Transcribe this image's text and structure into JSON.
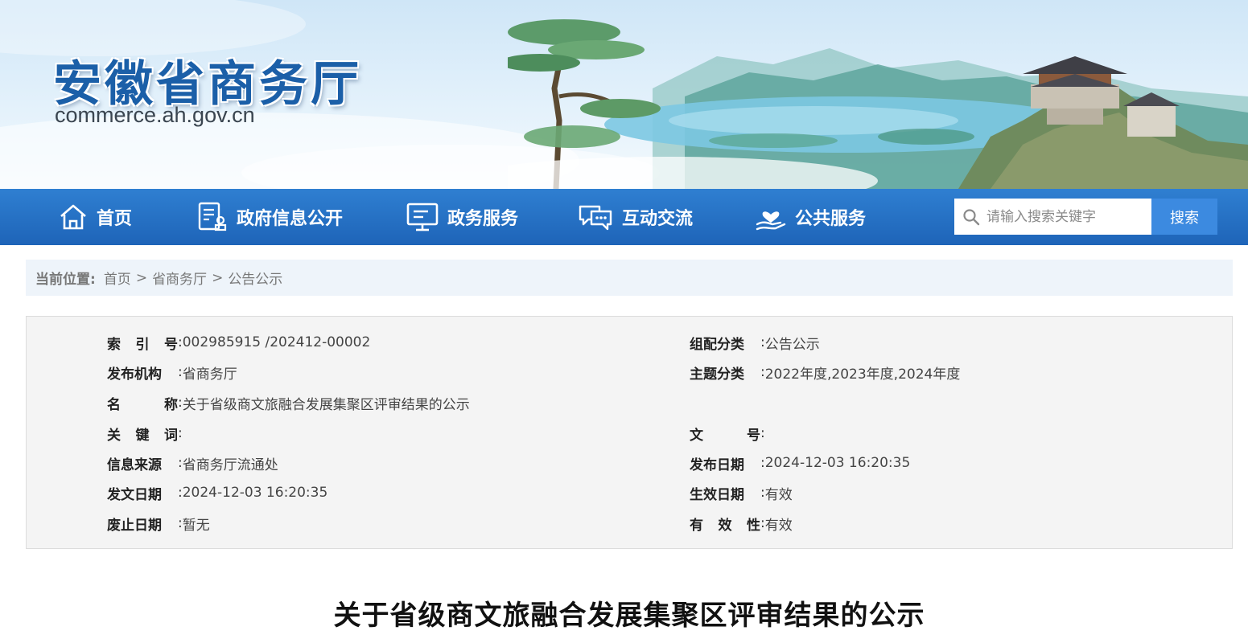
{
  "header": {
    "site_title": "安徽省商务厅",
    "site_domain": "commerce.ah.gov.cn"
  },
  "nav": {
    "items": [
      {
        "label": "首页",
        "icon": "home-icon"
      },
      {
        "label": "政府信息公开",
        "icon": "document-stamp-icon"
      },
      {
        "label": "政务服务",
        "icon": "monitor-icon"
      },
      {
        "label": "互动交流",
        "icon": "chat-bubbles-icon"
      },
      {
        "label": "公共服务",
        "icon": "hand-heart-icon"
      }
    ],
    "search": {
      "placeholder": "请输入搜索关键字",
      "button_label": "搜索"
    }
  },
  "breadcrumb": {
    "label": "当前位置:",
    "items": [
      "首页",
      "省商务厅",
      "公告公示"
    ],
    "separator": ">"
  },
  "info": {
    "index_no": {
      "key": [
        "索",
        "引",
        "号"
      ],
      "value": "002985915 /202412-00002"
    },
    "publisher": {
      "key": [
        "发布机构"
      ],
      "value": "省商务厅"
    },
    "name": {
      "key": [
        "名",
        "称"
      ],
      "value": "关于省级商文旅融合发展集聚区评审结果的公示"
    },
    "keywords": {
      "key": [
        "关",
        "键",
        "词"
      ],
      "value": ""
    },
    "source": {
      "key": [
        "信息来源"
      ],
      "value": "省商务厅流通处"
    },
    "issue_date": {
      "key": [
        "发文日期"
      ],
      "value": "2024-12-03 16:20:35"
    },
    "abolish_date": {
      "key": [
        "废止日期"
      ],
      "value": "暂无"
    },
    "category": {
      "key": [
        "组配分类"
      ],
      "value": "公告公示"
    },
    "topic": {
      "key": [
        "主题分类"
      ],
      "value": "2022年度,2023年度,2024年度"
    },
    "doc_no": {
      "key": [
        "文",
        "号"
      ],
      "value": ""
    },
    "publish_date": {
      "key": [
        "发布日期"
      ],
      "value": "2024-12-03 16:20:35"
    },
    "effective_date": {
      "key": [
        "生效日期"
      ],
      "value": "有效"
    },
    "validity": {
      "key": [
        "有",
        "效",
        "性"
      ],
      "value": "有效"
    }
  },
  "article": {
    "title": "关于省级商文旅融合发展集聚区评审结果的公示"
  },
  "colors": {
    "nav_top": "#2f7fd1",
    "nav_bottom": "#1e64b8",
    "title_blue": "#1b5fa8",
    "search_button": "#3c8ae0"
  }
}
